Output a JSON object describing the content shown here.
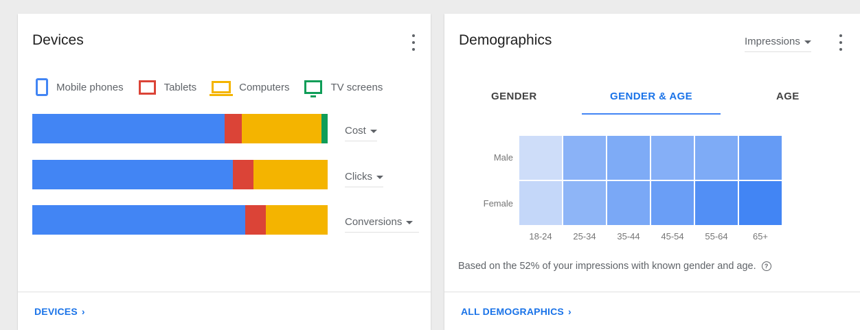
{
  "devices": {
    "title": "Devices",
    "legend": [
      {
        "label": "Mobile phones",
        "color": "#4285f4",
        "icon": "mobile-phone-icon"
      },
      {
        "label": "Tablets",
        "color": "#db4437",
        "icon": "tablet-icon"
      },
      {
        "label": "Computers",
        "color": "#f4b400",
        "icon": "computer-icon"
      },
      {
        "label": "TV screens",
        "color": "#0f9d58",
        "icon": "tv-screen-icon"
      }
    ],
    "metrics": [
      {
        "label": "Cost",
        "shares": [
          65,
          6,
          27,
          2
        ]
      },
      {
        "label": "Clicks",
        "shares": [
          68,
          7,
          25,
          0
        ]
      },
      {
        "label": "Conversions",
        "shares": [
          72,
          7,
          21,
          0
        ]
      }
    ],
    "footer_link": "DEVICES"
  },
  "demographics": {
    "title": "Demographics",
    "metric_select": "Impressions",
    "tabs": [
      "GENDER",
      "GENDER & AGE",
      "AGE"
    ],
    "active_tab": "GENDER & AGE",
    "rows": [
      "Male",
      "Female"
    ],
    "columns": [
      "18-24",
      "25-34",
      "35-44",
      "45-54",
      "55-64",
      "65+"
    ],
    "intensity": [
      [
        0.12,
        0.55,
        0.62,
        0.58,
        0.62,
        0.78
      ],
      [
        0.18,
        0.52,
        0.65,
        0.75,
        0.9,
        1.0
      ]
    ],
    "note": "Based on the 52% of your impressions with known gender and age.",
    "footer_link": "ALL DEMOGRAPHICS"
  }
}
